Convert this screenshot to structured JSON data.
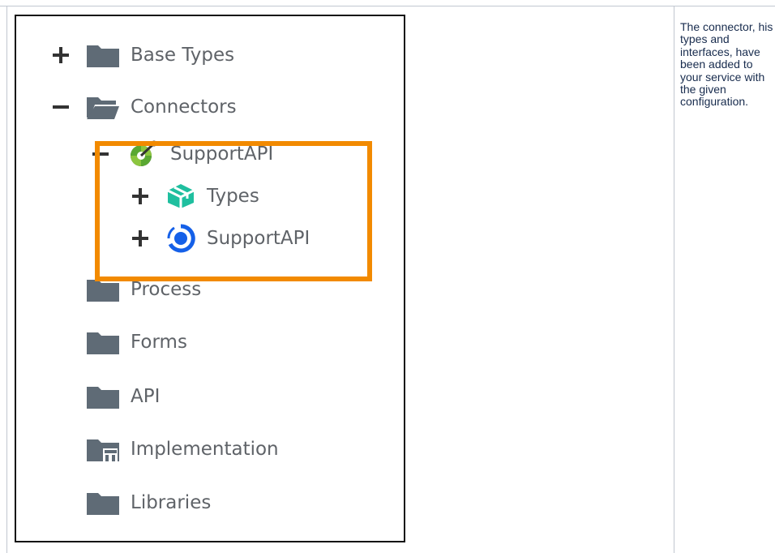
{
  "tree": {
    "items": [
      {
        "label": "Base Types",
        "expander": "plus",
        "icon": "folder-icon"
      },
      {
        "label": "Connectors",
        "expander": "minus",
        "icon": "folder-open-icon"
      },
      {
        "label": "SupportAPI",
        "expander": "minus",
        "icon": "connector-icon"
      },
      {
        "label": "Types",
        "expander": "plus",
        "icon": "types-cube-icon"
      },
      {
        "label": "SupportAPI",
        "expander": "plus",
        "icon": "service-ring-icon"
      },
      {
        "label": "Process",
        "icon": "folder-icon"
      },
      {
        "label": "Forms",
        "icon": "folder-icon"
      },
      {
        "label": "API",
        "icon": "folder-icon"
      },
      {
        "label": "Implementation",
        "icon": "implementation-folder-icon"
      },
      {
        "label": "Libraries",
        "icon": "folder-icon"
      }
    ]
  },
  "note": {
    "text": "The connector, his types and interfaces, have been added to your service with the given configuration."
  },
  "colors": {
    "highlight": "#f28a00",
    "folder": "#5f6b76",
    "types_icon": "#1fbf9f",
    "service_icon": "#1560e8"
  }
}
